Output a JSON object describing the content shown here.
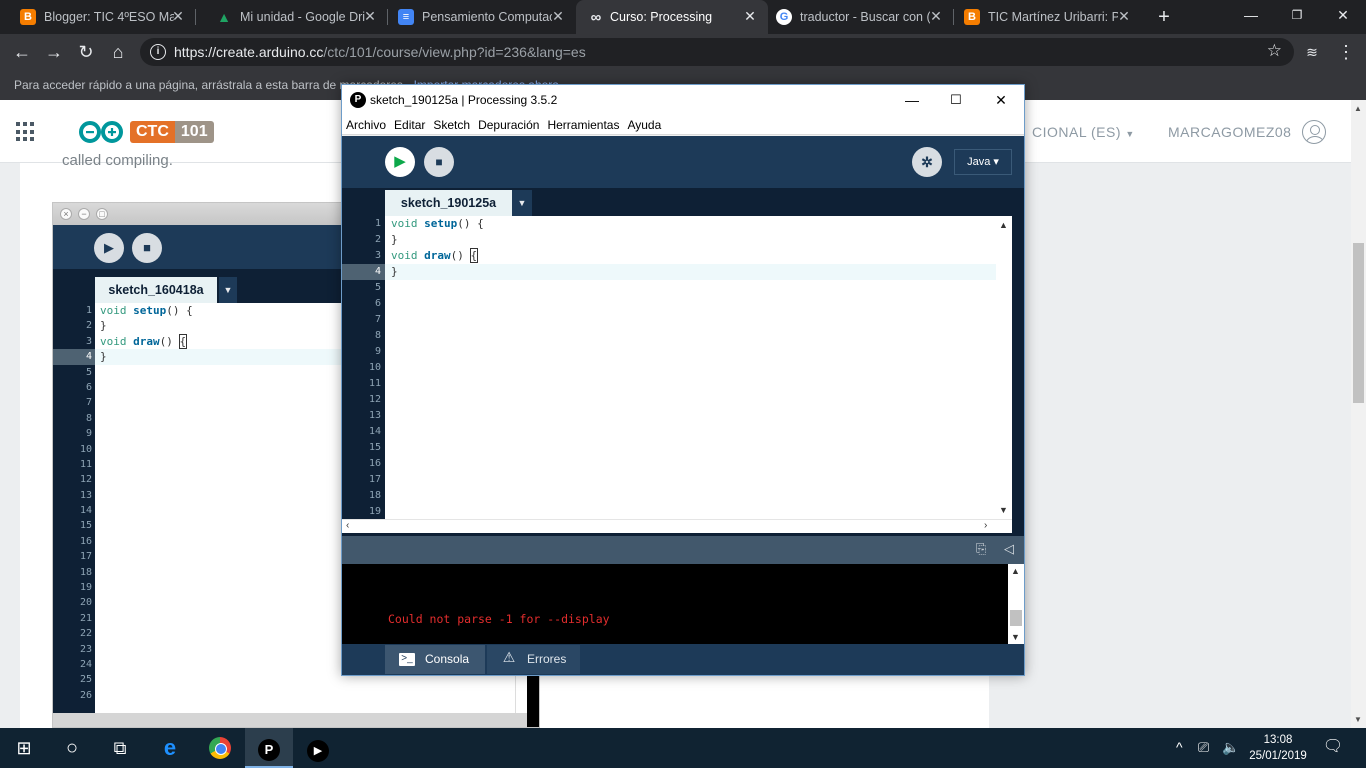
{
  "browser": {
    "tabs": [
      {
        "title": "Blogger: TIC 4ºESO Ma",
        "icon": "blogger-icon",
        "color": "#f57d00",
        "glyph": "B"
      },
      {
        "title": "Mi unidad - Google Dri",
        "icon": "google-drive-icon",
        "color": "#1fa463",
        "glyph": "▲"
      },
      {
        "title": "Pensamiento Computac",
        "icon": "google-docs-icon",
        "color": "#4285f4",
        "glyph": "≡"
      },
      {
        "title": "Curso: Processing",
        "icon": "arduino-icon",
        "color": "#35363a",
        "glyph": "∞"
      },
      {
        "title": "traductor - Buscar con (",
        "icon": "google-icon",
        "color": "#ffffff",
        "glyph": "G"
      },
      {
        "title": "TIC Martínez Uribarri: P",
        "icon": "blogger-icon",
        "color": "#f57d00",
        "glyph": "B"
      }
    ],
    "active_tab": 3,
    "url_host": "https://create.arduino.cc",
    "url_path": "/ctc/101/course/view.php?id=236&lang=es",
    "bookmark_hint": "Para acceder rápido a una página, arrástrala a esta barra de marcadores.",
    "bookmark_import": "Importar marcadores ahora..."
  },
  "site": {
    "logo_ctc": "CTC",
    "logo_num": "101",
    "nav_lang": "CIONAL (ES)",
    "nav_user": "MARCAGOMEZ08",
    "content_text": "called compiling."
  },
  "lesson_image": {
    "tab": "sketch_160418a",
    "line_numbers": [
      "1",
      "2",
      "3",
      "4",
      "5",
      "6",
      "7",
      "8",
      "9",
      "10",
      "11",
      "12",
      "13",
      "14",
      "15",
      "16",
      "17",
      "18",
      "19",
      "20",
      "21",
      "22",
      "23",
      "24",
      "25",
      "26"
    ],
    "highlight_line": 4
  },
  "processing": {
    "window_title": "sketch_190125a | Processing 3.5.2",
    "menus": [
      "Archivo",
      "Editar",
      "Sketch",
      "Depuración",
      "Herramientas",
      "Ayuda"
    ],
    "mode": "Java ▾",
    "tab": "sketch_190125a",
    "code": [
      {
        "kw": "void",
        "fn": "setup",
        "rest": "() {"
      },
      {
        "text": "}"
      },
      {
        "kw": "void",
        "fn": "draw",
        "rest": "() "
      },
      {
        "text": "}"
      }
    ],
    "line_numbers": [
      "1",
      "2",
      "3",
      "4",
      "5",
      "6",
      "7",
      "8",
      "9",
      "10",
      "11",
      "12",
      "13",
      "14",
      "15",
      "16",
      "17",
      "18",
      "19"
    ],
    "highlight_line": 4,
    "console_message": "Could not parse -1 for --display",
    "footer_tabs": [
      "Consola",
      "Errores"
    ]
  },
  "taskbar": {
    "time": "13:08",
    "date": "25/01/2019"
  },
  "colors": {
    "processing_toolbar": "#1d3a58",
    "processing_bg": "#0e2035",
    "console_error": "#e32d2d",
    "chrome_bg": "#202124"
  }
}
